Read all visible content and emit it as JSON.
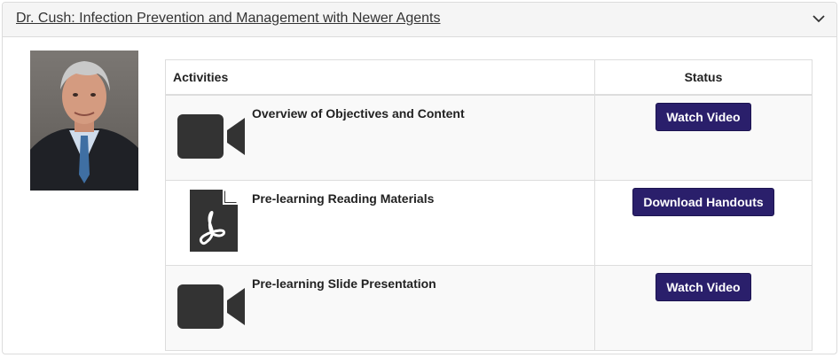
{
  "panel": {
    "title": "Dr. Cush: Infection Prevention and Management with Newer Agents",
    "chevron_icon": "chevron-down-icon"
  },
  "table": {
    "headers": {
      "activities": "Activities",
      "status": "Status"
    },
    "rows": [
      {
        "icon": "video-camera-icon",
        "label": "Overview of Objectives and Content",
        "button": "Watch Video"
      },
      {
        "icon": "pdf-file-icon",
        "label": "Pre-learning Reading Materials",
        "button": "Download Handouts"
      },
      {
        "icon": "video-camera-icon",
        "label": "Pre-learning Slide Presentation",
        "button": "Watch Video"
      }
    ]
  },
  "colors": {
    "button_bg": "#2a1f6b",
    "icon": "#333333",
    "header_bg": "#f5f5f5"
  }
}
